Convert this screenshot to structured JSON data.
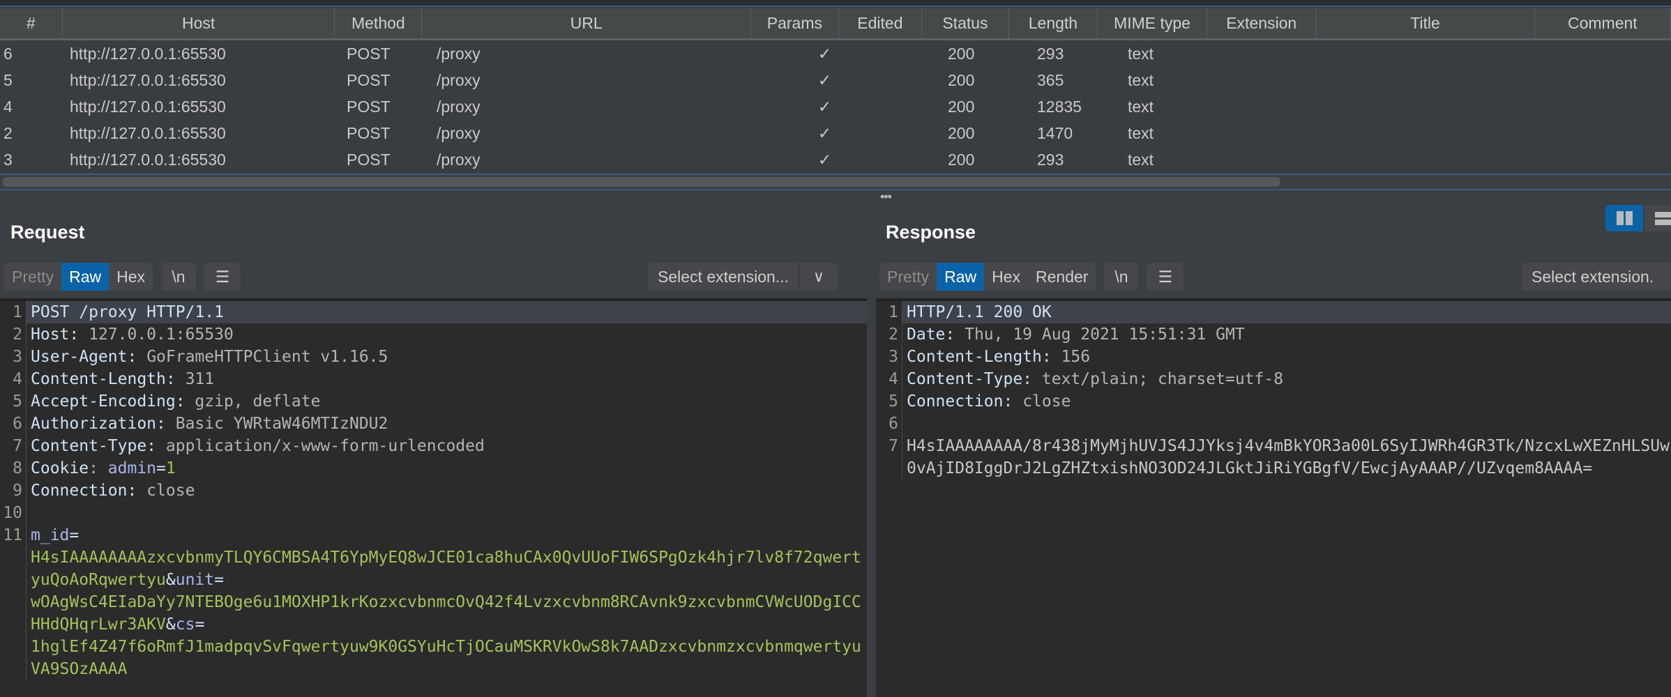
{
  "table": {
    "columns": [
      "#",
      "Host",
      "Method",
      "URL",
      "Params",
      "Edited",
      "Status",
      "Length",
      "MIME type",
      "Extension",
      "Title",
      "Comment"
    ],
    "rows": [
      {
        "num": "6",
        "host": "http://127.0.0.1:65530",
        "method": "POST",
        "url": "/proxy",
        "params": "✓",
        "edited": "",
        "status": "200",
        "length": "293",
        "mime": "text",
        "ext": "",
        "title": ""
      },
      {
        "num": "5",
        "host": "http://127.0.0.1:65530",
        "method": "POST",
        "url": "/proxy",
        "params": "✓",
        "edited": "",
        "status": "200",
        "length": "365",
        "mime": "text",
        "ext": "",
        "title": ""
      },
      {
        "num": "4",
        "host": "http://127.0.0.1:65530",
        "method": "POST",
        "url": "/proxy",
        "params": "✓",
        "edited": "",
        "status": "200",
        "length": "12835",
        "mime": "text",
        "ext": "",
        "title": ""
      },
      {
        "num": "2",
        "host": "http://127.0.0.1:65530",
        "method": "POST",
        "url": "/proxy",
        "params": "✓",
        "edited": "",
        "status": "200",
        "length": "1470",
        "mime": "text",
        "ext": "",
        "title": ""
      },
      {
        "num": "3",
        "host": "http://127.0.0.1:65530",
        "method": "POST",
        "url": "/proxy",
        "params": "✓",
        "edited": "",
        "status": "200",
        "length": "293",
        "mime": "text",
        "ext": "",
        "title": ""
      }
    ]
  },
  "request": {
    "title": "Request",
    "tabs": [
      "Pretty",
      "Raw",
      "Hex"
    ],
    "active_tab": "Raw",
    "newline_label": "\\n",
    "select_extension": "Select extension...",
    "lines": [
      {
        "n": "1",
        "text": "POST /proxy HTTP/1.1"
      },
      {
        "n": "2",
        "key": "Host",
        "value": "127.0.0.1:65530"
      },
      {
        "n": "3",
        "key": "User-Agent",
        "value": "GoFrameHTTPClient v1.16.5"
      },
      {
        "n": "4",
        "key": "Content-Length",
        "value": "311"
      },
      {
        "n": "5",
        "key": "Accept-Encoding",
        "value": "gzip, deflate"
      },
      {
        "n": "6",
        "key": "Authorization",
        "value": "Basic YWRtaW46MTIzNDU2"
      },
      {
        "n": "7",
        "key": "Content-Type",
        "value": "application/x-www-form-urlencoded"
      },
      {
        "n": "8",
        "key": "Cookie",
        "cookie_name": "admin",
        "cookie_value": "1"
      },
      {
        "n": "9",
        "key": "Connection",
        "value": "close"
      },
      {
        "n": "10"
      },
      {
        "n": "11",
        "params": [
          {
            "name": "m_id",
            "value": "H4sIAAAAAAAAzxcvbnmyTLQY6CMBSA4T6YpMyEQ8wJCE01ca8huCAx0QvUUoFIW6SPgOzk4hjr7lv8f72qwertyuQoAoRqwertyu"
          },
          {
            "name": "unit",
            "value": "wOAgWsC4EIaDaYy7NTEBOge6u1MOXHP1krKozxcvbnmcOvQ42f4Lvzxcvbnm8RCAvnk9zxcvbnmCVWcUODgICCHHdQHqrLwr3AKV"
          },
          {
            "name": "cs",
            "value": "1hglEf4Z47f6oRmfJ1madpqvSvFqwertyuw9K0GSYuHcTjOCauMSKRVkOwS8k7AADzxcvbnmzxcvbnmqwertyuVA9SOzAAAA"
          }
        ]
      }
    ]
  },
  "response": {
    "title": "Response",
    "tabs": [
      "Pretty",
      "Raw",
      "Hex",
      "Render"
    ],
    "active_tab": "Raw",
    "newline_label": "\\n",
    "select_extension": "Select extension.",
    "lines": [
      {
        "n": "1",
        "text": "HTTP/1.1 200 OK"
      },
      {
        "n": "2",
        "key": "Date",
        "value": "Thu, 19 Aug 2021 15:51:31 GMT"
      },
      {
        "n": "3",
        "key": "Content-Length",
        "value": "156"
      },
      {
        "n": "4",
        "key": "Content-Type",
        "value": "text/plain; charset=utf-8"
      },
      {
        "n": "5",
        "key": "Connection",
        "value": "close"
      },
      {
        "n": "6"
      },
      {
        "n": "7",
        "body": [
          "H4sIAAAAAAAA/8r438jMyMjhUVJS4JJYksj4v4mBkYOR3a00L6SyIJWRh4GR3Tk/NzcxLwXEZnHLSUw",
          "0vAjID8IggDrJ2LgZHZtxishNO3OD24JLGktJiRiYGBgfV/EwcjAyAAAP//UZvqem8AAAA="
        ]
      }
    ]
  },
  "view_toggle": {
    "active": "side-by-side"
  },
  "colors": {
    "accent": "#0b63a7",
    "param_value": "#a4c35a",
    "param_name": "#aab4ee",
    "header_key": "#cde2f5"
  }
}
